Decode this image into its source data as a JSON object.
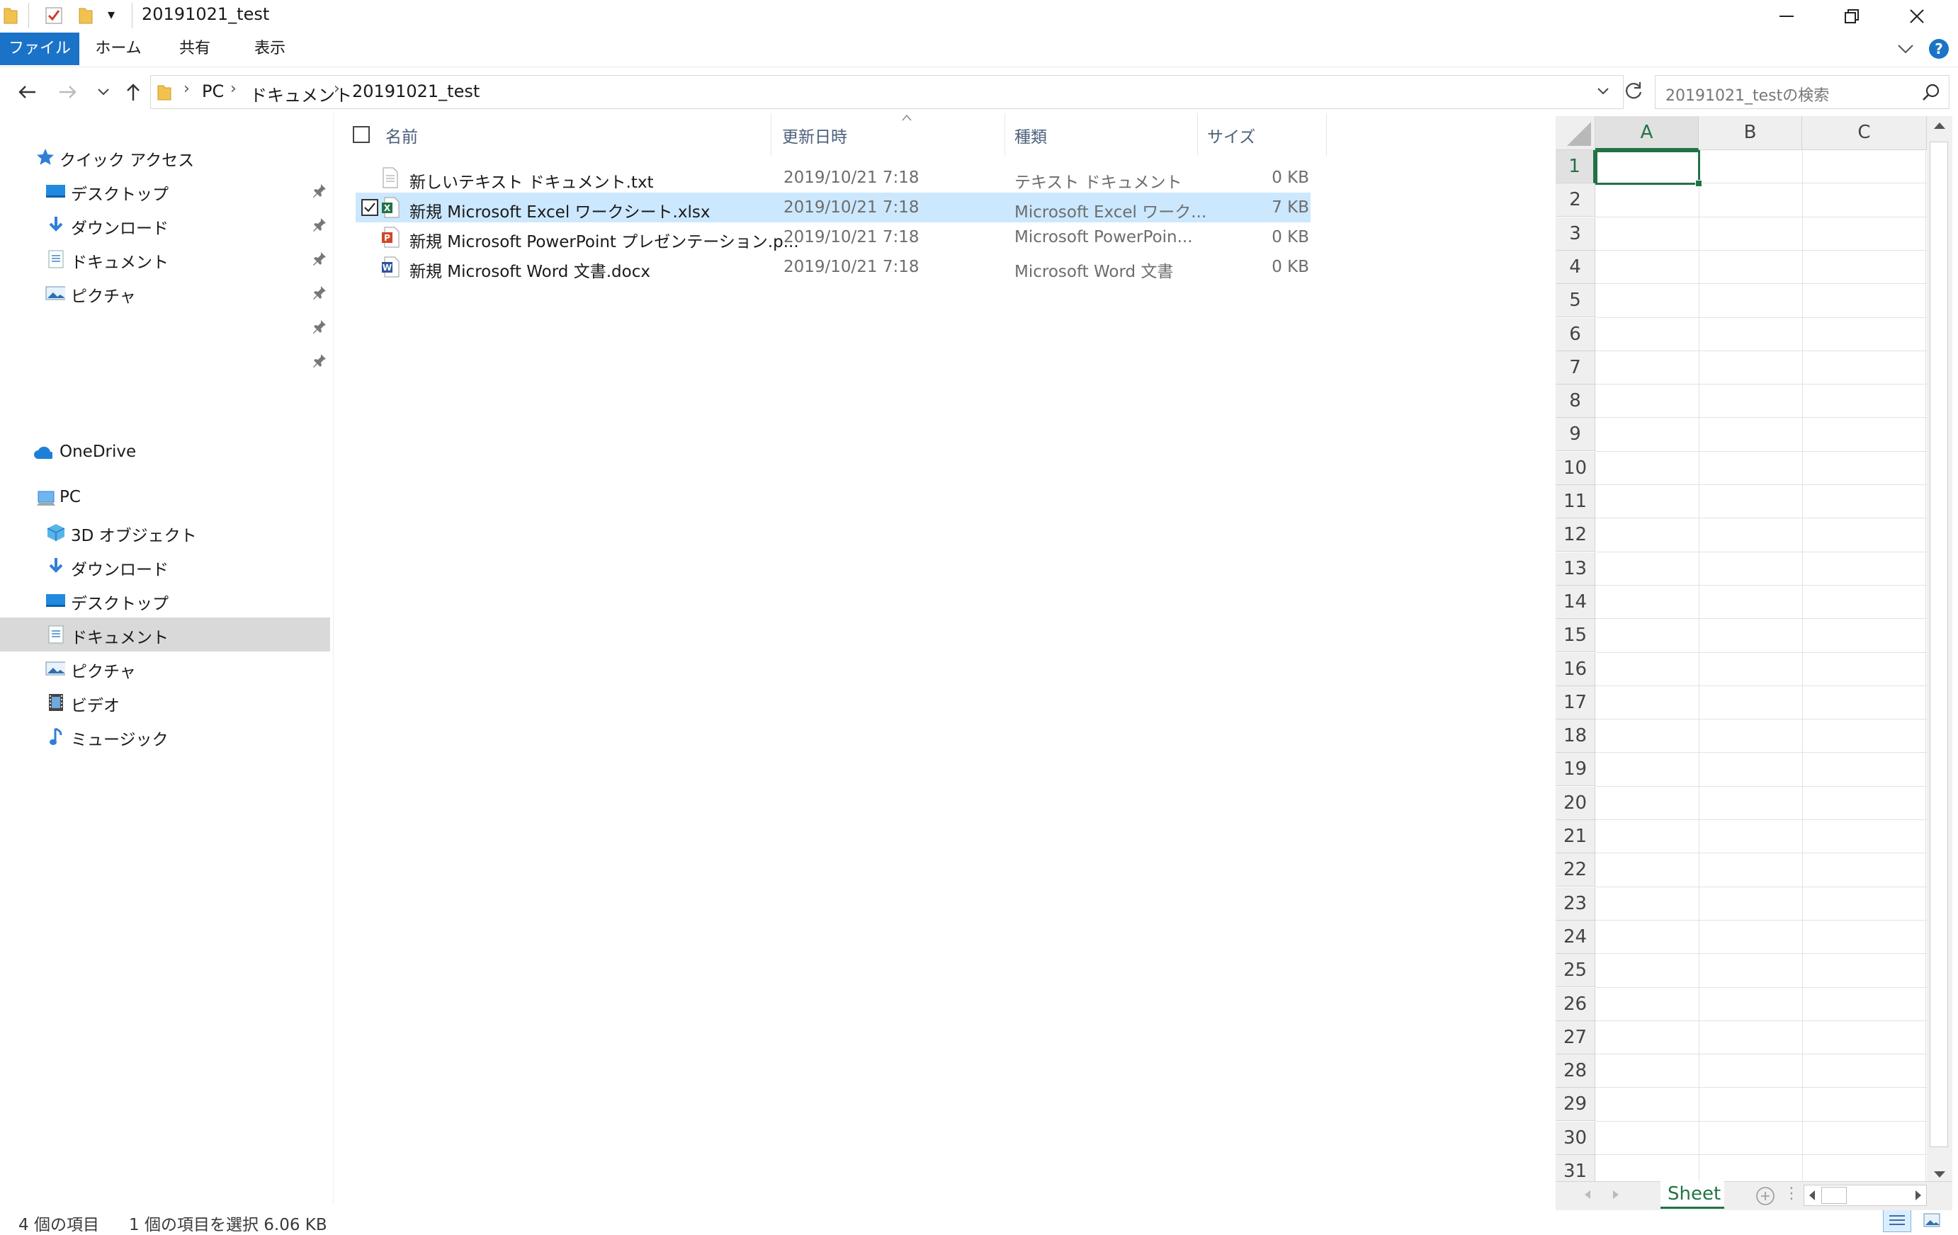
{
  "window": {
    "title": "20191021_test",
    "qat_dropdown": "▾"
  },
  "ribbon": {
    "tabs": [
      {
        "label": "ファイル",
        "active": true
      },
      {
        "label": "ホーム"
      },
      {
        "label": "共有"
      },
      {
        "label": "表示"
      }
    ]
  },
  "address": {
    "crumbs": [
      "PC",
      "ドキュメント",
      "20191021_test"
    ],
    "search_placeholder": "20191021_testの検索"
  },
  "nav": {
    "quick_access": "クイック アクセス",
    "quick_items": [
      "デスクトップ",
      "ダウンロード",
      "ドキュメント",
      "ピクチャ"
    ],
    "onedrive": "OneDrive",
    "pc": "PC",
    "pc_items": [
      "3D オブジェクト",
      "ダウンロード",
      "デスクトップ",
      "ドキュメント",
      "ピクチャ",
      "ビデオ",
      "ミュージック"
    ]
  },
  "files": {
    "columns": {
      "name": "名前",
      "date": "更新日時",
      "type": "種類",
      "size": "サイズ"
    },
    "rows": [
      {
        "name": "新しいテキスト ドキュメント.txt",
        "date": "2019/10/21 7:18",
        "type": "テキスト ドキュメント",
        "size": "0 KB",
        "icon": "text-file-icon"
      },
      {
        "name": "新規 Microsoft Excel ワークシート.xlsx",
        "date": "2019/10/21 7:18",
        "type": "Microsoft Excel ワーク...",
        "size": "7 KB",
        "icon": "excel-file-icon",
        "selected": true
      },
      {
        "name": "新規 Microsoft PowerPoint プレゼンテーション.p...",
        "date": "2019/10/21 7:18",
        "type": "Microsoft PowerPoin...",
        "size": "0 KB",
        "icon": "powerpoint-file-icon"
      },
      {
        "name": "新規 Microsoft Word 文書.docx",
        "date": "2019/10/21 7:18",
        "type": "Microsoft Word 文書",
        "size": "0 KB",
        "icon": "word-file-icon"
      }
    ]
  },
  "status": {
    "count": "4 個の項目",
    "selection": "1 個の項目を選択  6.06 KB"
  },
  "preview": {
    "columns": [
      "A",
      "B",
      "C"
    ],
    "rows": [
      "1",
      "2",
      "3",
      "4",
      "5",
      "6",
      "7",
      "8",
      "9",
      "10",
      "11",
      "12",
      "13",
      "14",
      "15",
      "16",
      "17",
      "18",
      "19",
      "20",
      "21",
      "22",
      "23",
      "24",
      "25",
      "26",
      "27",
      "28",
      "29",
      "30",
      "31"
    ],
    "sheet_tab": "Sheet",
    "accent": "#217346"
  },
  "colors": {
    "accent": "#1a73c7",
    "selection": "#cce8ff"
  }
}
